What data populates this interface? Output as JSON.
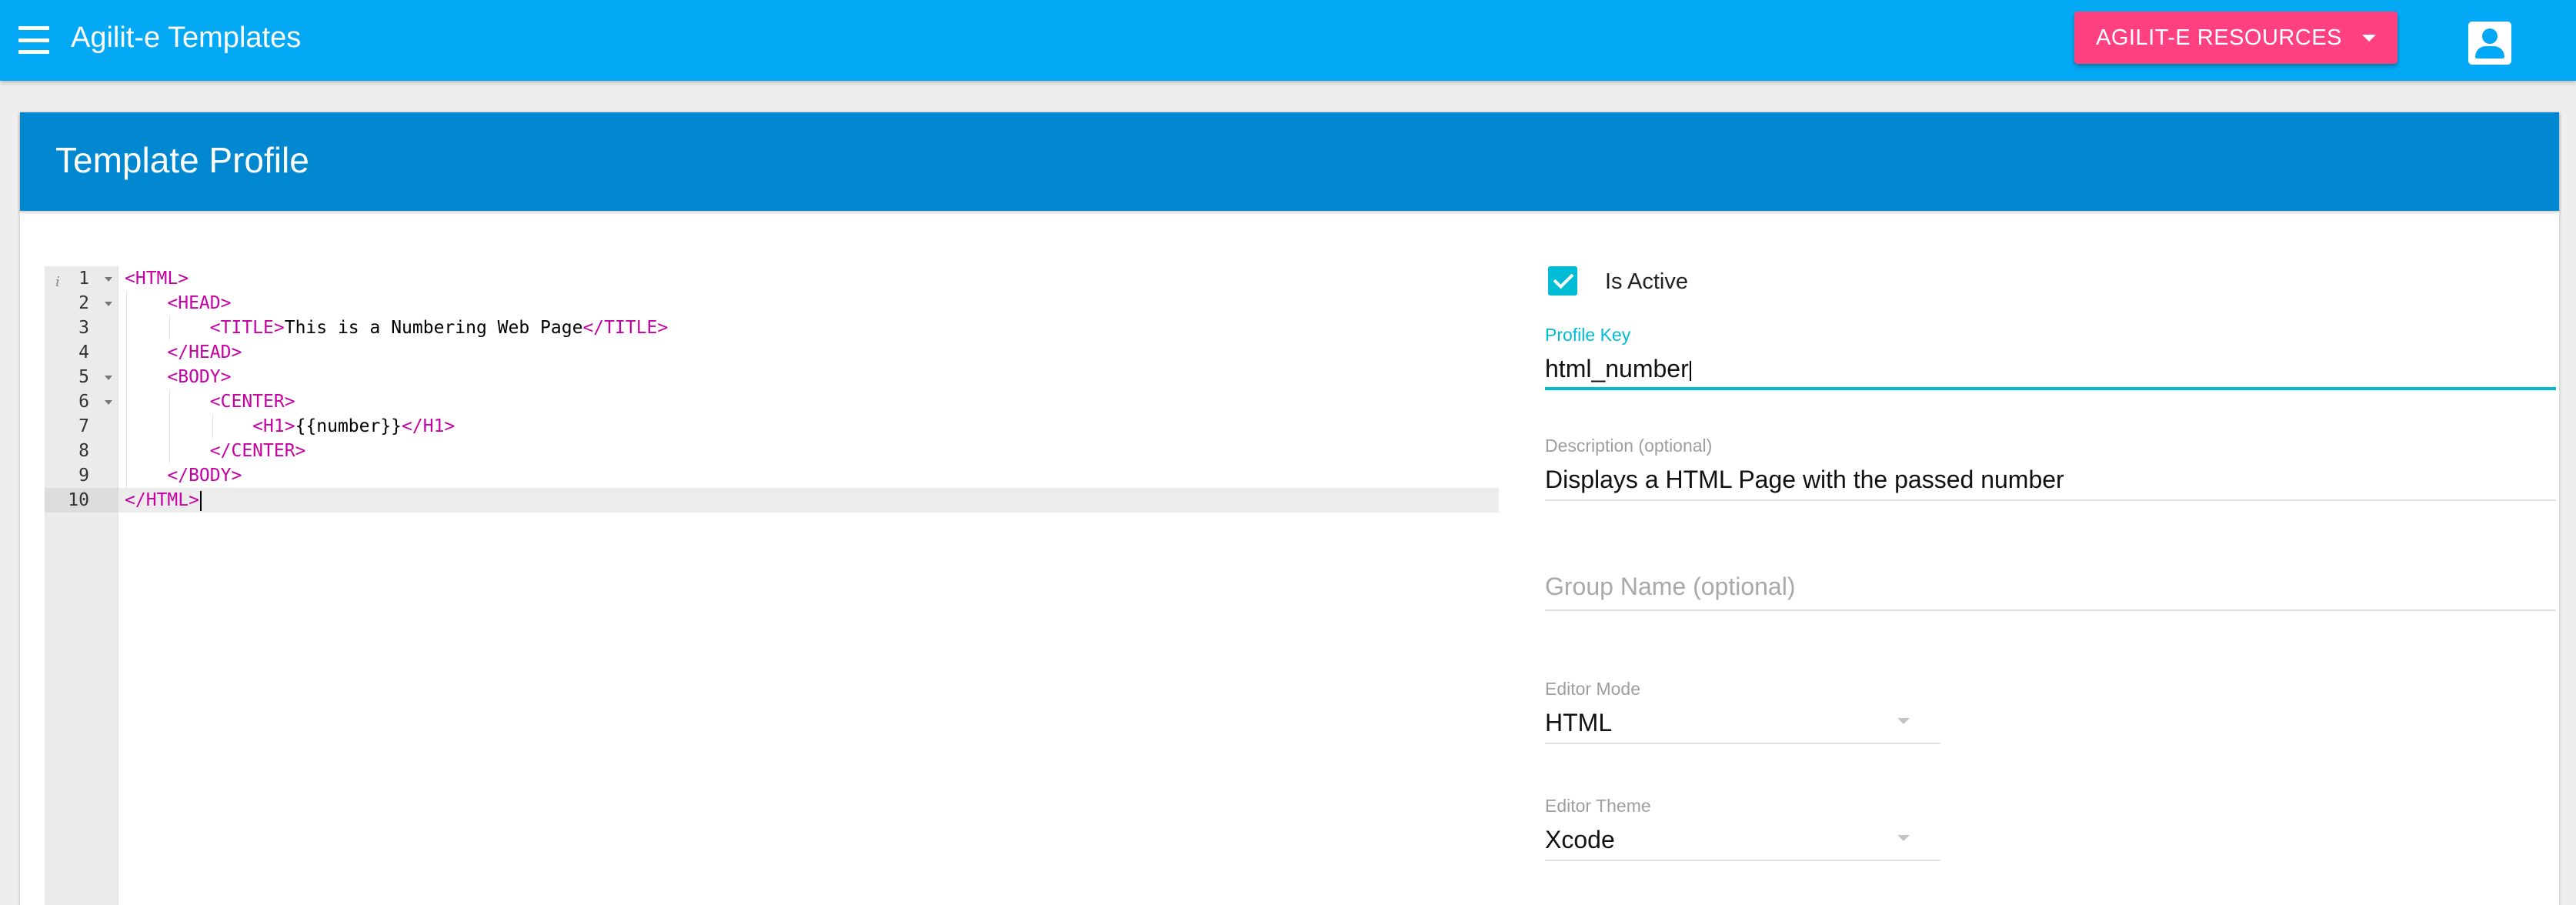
{
  "appbar": {
    "title": "Agilit-e Templates",
    "resources_label": "AGILIT-E RESOURCES",
    "menu_icon": "menu-icon",
    "account_icon": "account-box-icon"
  },
  "card": {
    "title": "Template Profile"
  },
  "editor": {
    "lines": [
      {
        "num": "1",
        "indent": 0,
        "open": "<HTML>",
        "text": "",
        "close": ""
      },
      {
        "num": "2",
        "indent": 1,
        "open": "<HEAD>",
        "text": "",
        "close": ""
      },
      {
        "num": "3",
        "indent": 2,
        "open": "<TITLE>",
        "text": "This is a Numbering Web Page",
        "close": "</TITLE>"
      },
      {
        "num": "4",
        "indent": 1,
        "open": "</HEAD>",
        "text": "",
        "close": ""
      },
      {
        "num": "5",
        "indent": 1,
        "open": "<BODY>",
        "text": "",
        "close": ""
      },
      {
        "num": "6",
        "indent": 2,
        "open": "<CENTER>",
        "text": "",
        "close": ""
      },
      {
        "num": "7",
        "indent": 3,
        "open": "<H1>",
        "text": "{{number}}",
        "close": "</H1>"
      },
      {
        "num": "8",
        "indent": 2,
        "open": "</CENTER>",
        "text": "",
        "close": ""
      },
      {
        "num": "9",
        "indent": 1,
        "open": "</BODY>",
        "text": "",
        "close": ""
      },
      {
        "num": "10",
        "indent": 0,
        "open": "</HTML>",
        "text": "",
        "close": ""
      }
    ],
    "fold_lines": [
      "1",
      "2",
      "5",
      "6"
    ],
    "active_line": "10",
    "info_marker": "i"
  },
  "form": {
    "is_active_label": "Is Active",
    "is_active_checked": true,
    "profile_key_label": "Profile Key",
    "profile_key_value": "html_number",
    "description_label": "Description (optional)",
    "description_value": "Displays a HTML Page with the passed number",
    "group_name_placeholder": "Group Name (optional)",
    "editor_mode_label": "Editor Mode",
    "editor_mode_value": "HTML",
    "editor_theme_label": "Editor Theme",
    "editor_theme_value": "Xcode"
  },
  "colors": {
    "appbar": "#03a9f4",
    "card_header": "#0288d1",
    "accent": "#ff4081",
    "focus": "#00bcd4",
    "tag": "#c800a4"
  }
}
